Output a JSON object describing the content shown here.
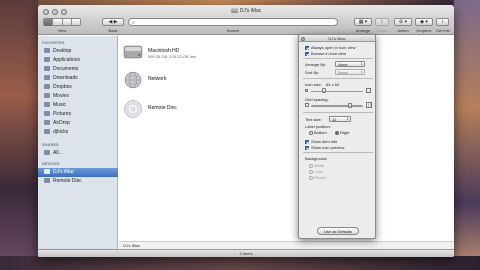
{
  "window": {
    "title": "DJ's iMac"
  },
  "toolbar": {
    "back_label": "Back",
    "view_label": "View",
    "search_label": "Search",
    "arrange_label": "Arrange",
    "share_label": "Share",
    "action_label": "Action",
    "dropbox_label": "Dropbox",
    "getinfo_label": "Get Info"
  },
  "sidebar": {
    "favorites_header": "FAVORITES",
    "shared_header": "SHARED",
    "devices_header": "DEVICES",
    "favorites": [
      {
        "label": "Desktop",
        "icon": "desktop-icon"
      },
      {
        "label": "Applications",
        "icon": "applications-icon"
      },
      {
        "label": "Documents",
        "icon": "documents-icon"
      },
      {
        "label": "Downloads",
        "icon": "downloads-icon"
      },
      {
        "label": "Dropbox",
        "icon": "dropbox-icon"
      },
      {
        "label": "Movies",
        "icon": "movies-icon"
      },
      {
        "label": "Music",
        "icon": "music-icon"
      },
      {
        "label": "Pictures",
        "icon": "pictures-icon"
      },
      {
        "label": "AirDrop",
        "icon": "airdrop-icon"
      },
      {
        "label": "djhicks",
        "icon": "home-icon"
      }
    ],
    "shared": [
      {
        "label": "All...",
        "icon": "network-icon"
      }
    ],
    "devices": [
      {
        "label": "DJ's iMac",
        "icon": "imac-icon",
        "selected": true
      },
      {
        "label": "Remote Disc",
        "icon": "remote-disc-icon",
        "selected": false
      }
    ]
  },
  "content": {
    "items": [
      {
        "name": "Macintosh HD",
        "sub": "999.35 GB, 576.23 GB free",
        "icon": "hard-drive-icon"
      },
      {
        "name": "Network",
        "sub": "",
        "icon": "network-globe-icon"
      },
      {
        "name": "Remote Disc",
        "sub": "",
        "icon": "disc-icon"
      }
    ]
  },
  "pathbar": {
    "label": "DJ's iMac"
  },
  "statusbar": {
    "text": "3 items"
  },
  "view_options": {
    "title": "DJ's iMac",
    "always_open_label": "Always open in icon view",
    "always_open": true,
    "browse_label": "Browse in icon view",
    "browse": true,
    "arrange_by_label": "Arrange By:",
    "arrange_by_value": "None",
    "sort_by_label": "Sort By:",
    "sort_by_value": "None",
    "icon_size_label": "Icon size:",
    "icon_size_value": "64 x 64",
    "icon_size_fraction": 0.25,
    "grid_spacing_label": "Grid spacing:",
    "grid_spacing_fraction": 0.75,
    "text_size_label": "Text size:",
    "text_size_value": "12",
    "label_position_label": "Label position:",
    "label_bottom": "Bottom",
    "label_right": "Right",
    "label_position_selected": "Right",
    "show_item_info_label": "Show item info",
    "show_item_info": true,
    "show_icon_preview_label": "Show icon preview",
    "show_icon_preview": true,
    "background_label": "Background:",
    "bg_white": "White",
    "bg_color": "Color",
    "bg_picture": "Picture",
    "use_defaults_label": "Use as Defaults"
  },
  "colors": {
    "selection": "#3b6fbf",
    "sidebar_bg": "#dde3ea",
    "checkbox_on": "#3e77cc"
  }
}
